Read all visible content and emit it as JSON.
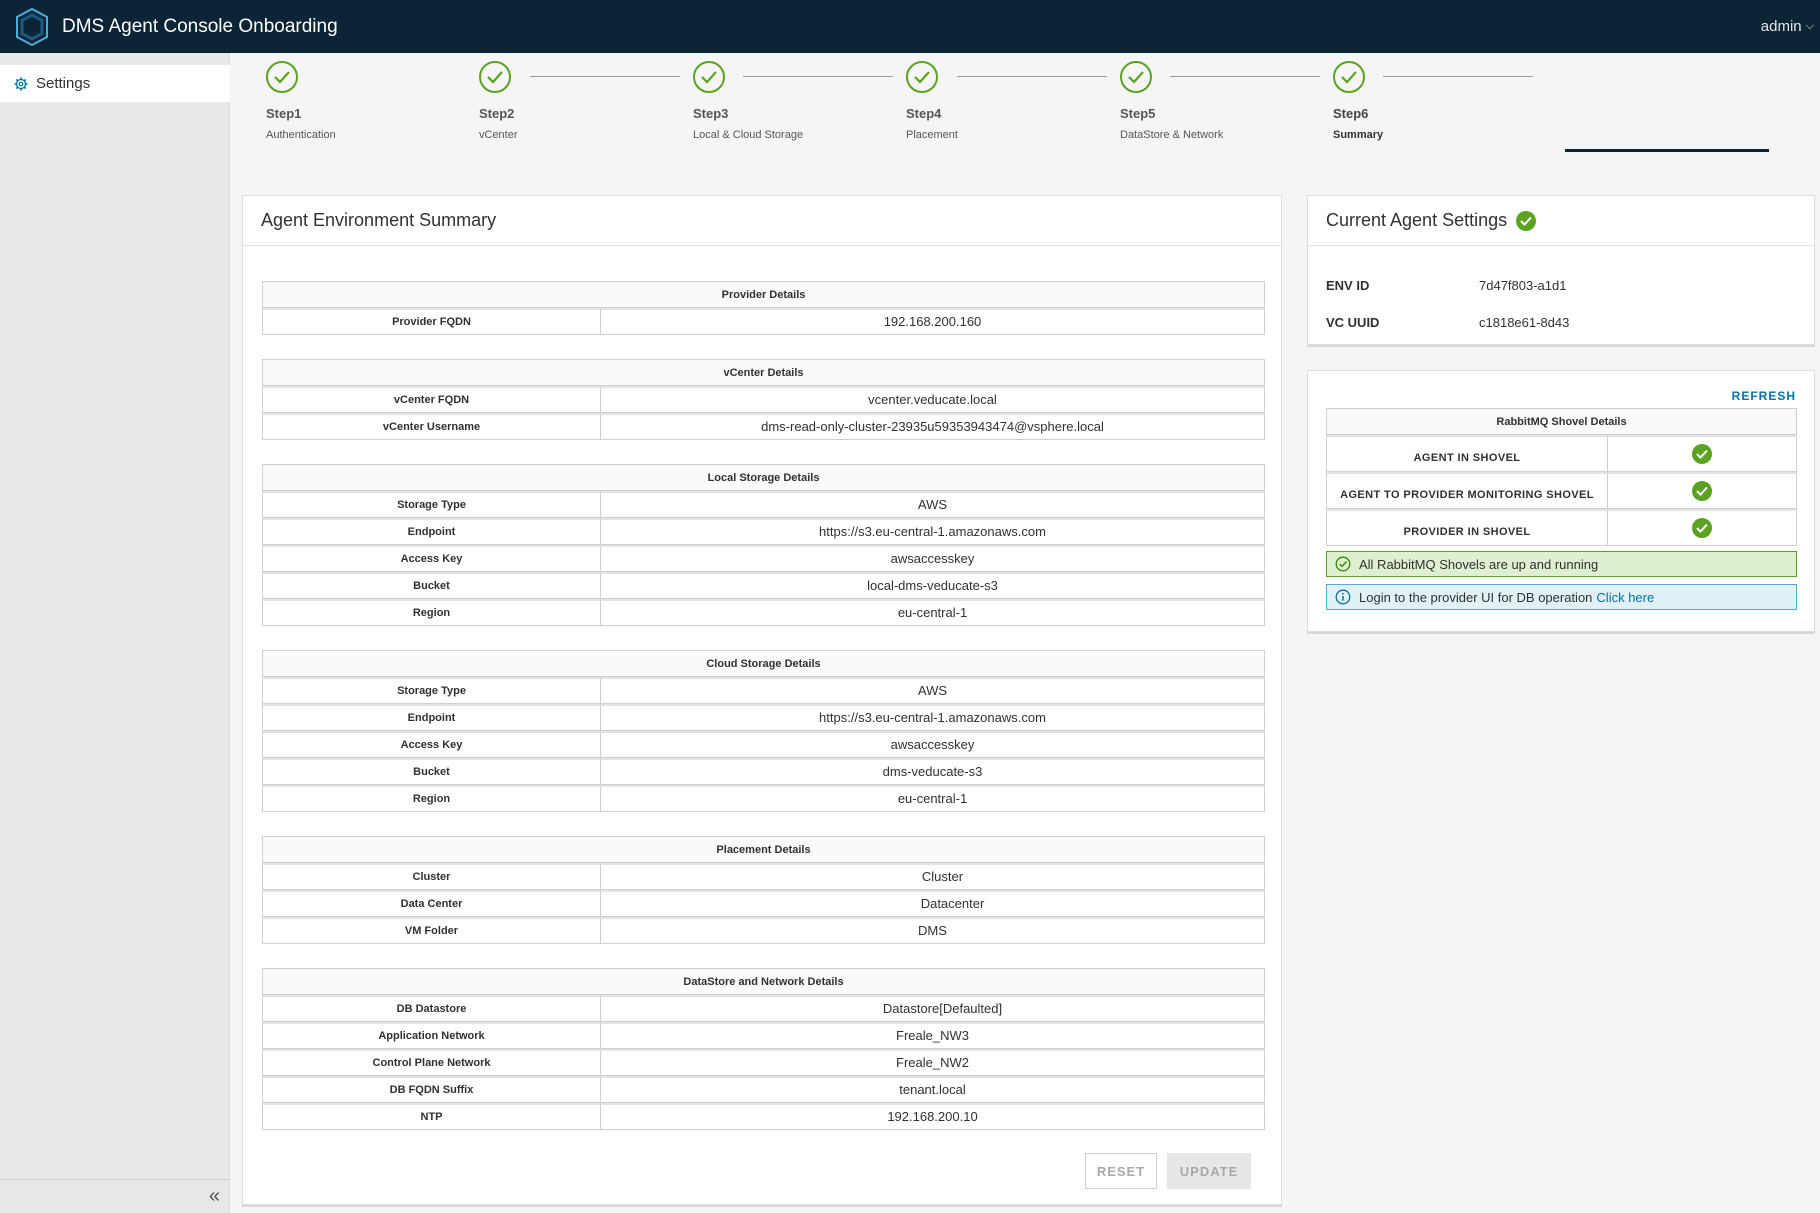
{
  "header": {
    "title": "DMS Agent Console Onboarding",
    "user": "admin"
  },
  "sidebar": {
    "items": [
      {
        "label": "Settings"
      }
    ]
  },
  "stepper": {
    "steps": [
      {
        "name": "Step1",
        "sub": "Authentication"
      },
      {
        "name": "Step2",
        "sub": "vCenter"
      },
      {
        "name": "Step3",
        "sub": "Local & Cloud Storage"
      },
      {
        "name": "Step4",
        "sub": "Placement"
      },
      {
        "name": "Step5",
        "sub": "DataStore & Network"
      },
      {
        "name": "Step6",
        "sub": "Summary"
      }
    ]
  },
  "summary": {
    "title": "Agent Environment Summary",
    "provider": {
      "title": "Provider Details",
      "rows": [
        {
          "label": "Provider FQDN",
          "value": "192.168.200.160"
        }
      ]
    },
    "vcenter": {
      "title": "vCenter Details",
      "rows": [
        {
          "label": "vCenter FQDN",
          "value": "vcenter.veducate.local"
        },
        {
          "label": "vCenter Username",
          "value": "dms-read-only-cluster-23935u59353943474@vsphere.local"
        }
      ]
    },
    "local_storage": {
      "title": "Local Storage Details",
      "rows": [
        {
          "label": "Storage Type",
          "value": "AWS"
        },
        {
          "label": "Endpoint",
          "value": "https://s3.eu-central-1.amazonaws.com"
        },
        {
          "label": "Access Key",
          "value": "awsaccesskey"
        },
        {
          "label": "Bucket",
          "value": "local-dms-veducate-s3"
        },
        {
          "label": "Region",
          "value": "eu-central-1"
        }
      ]
    },
    "cloud_storage": {
      "title": "Cloud Storage Details",
      "rows": [
        {
          "label": "Storage Type",
          "value": "AWS"
        },
        {
          "label": "Endpoint",
          "value": "https://s3.eu-central-1.amazonaws.com"
        },
        {
          "label": "Access Key",
          "value": "awsaccesskey"
        },
        {
          "label": "Bucket",
          "value": "dms-veducate-s3"
        },
        {
          "label": "Region",
          "value": "eu-central-1"
        }
      ]
    },
    "placement": {
      "title": "Placement Details",
      "rows": [
        {
          "label": "Cluster",
          "value": "Cluster"
        },
        {
          "label": "Data Center",
          "value": "Datacenter"
        },
        {
          "label": "VM Folder",
          "value": "DMS"
        }
      ]
    },
    "datastore_network": {
      "title": "DataStore and Network Details",
      "rows": [
        {
          "label": "DB Datastore",
          "value": "Datastore[Defaulted]"
        },
        {
          "label": "Application Network",
          "value": "Freale_NW3"
        },
        {
          "label": "Control Plane Network",
          "value": "Freale_NW2"
        },
        {
          "label": "DB FQDN Suffix",
          "value": "tenant.local"
        },
        {
          "label": "NTP",
          "value": "192.168.200.10"
        }
      ]
    },
    "buttons": {
      "reset": "RESET",
      "update": "UPDATE"
    }
  },
  "agent_settings": {
    "title": "Current Agent Settings",
    "env_id_label": "ENV ID",
    "env_id": "7d47f803-a1d1",
    "vc_uuid_label": "VC UUID",
    "vc_uuid": "c1818e61-8d43"
  },
  "shovels": {
    "refresh": "REFRESH",
    "title": "RabbitMQ Shovel Details",
    "rows": [
      {
        "label": "AGENT IN SHOVEL"
      },
      {
        "label": "AGENT TO PROVIDER MONITORING SHOVEL"
      },
      {
        "label": "PROVIDER IN SHOVEL"
      }
    ],
    "success_msg": "All RabbitMQ Shovels are up and running",
    "info_msg": "Login to the provider UI for DB operation",
    "info_link": "Click here"
  },
  "colors": {
    "header_bg": "#0c2536",
    "success": "#5aa220",
    "link": "#0072a3"
  }
}
